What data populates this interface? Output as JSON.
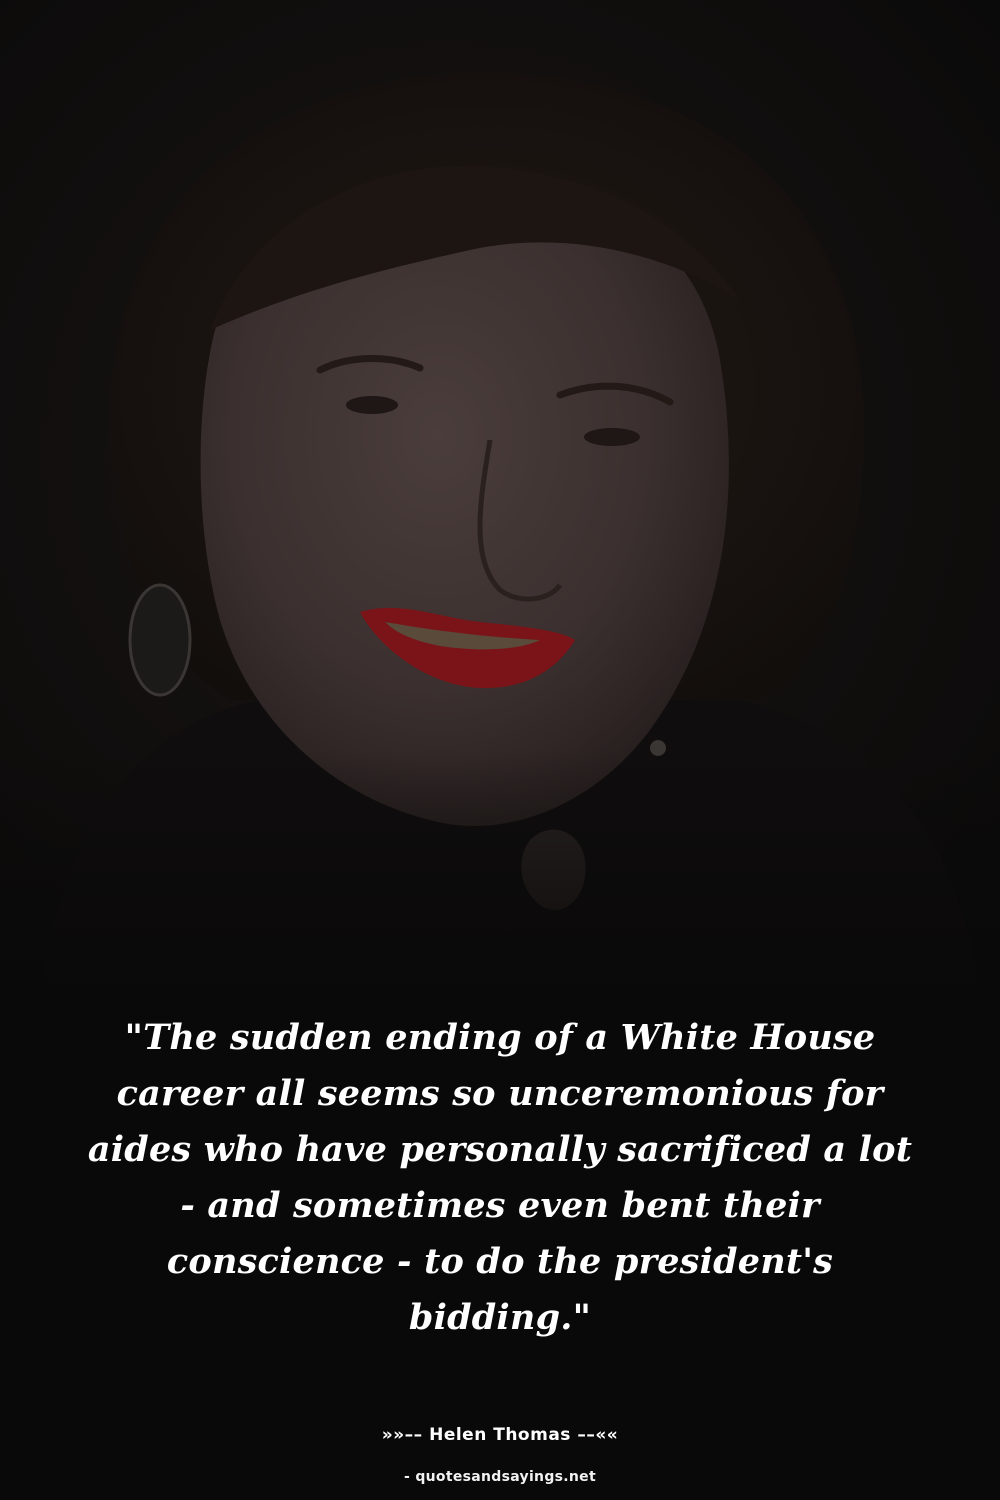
{
  "quote": {
    "text": "\"The sudden ending of a White House career all seems so unceremonious for aides who have personally sacrificed a lot - and sometimes even bent their conscience - to do the president's bidding.\""
  },
  "attribution": {
    "author_line": "»»–– Helen Thomas ––««",
    "source_line": "- quotesandsayings.net"
  },
  "background": {
    "photo": "portrait-photo",
    "colors": {
      "page": "#0a0909",
      "text": "#ffffff",
      "lips": "#7a1418"
    }
  }
}
